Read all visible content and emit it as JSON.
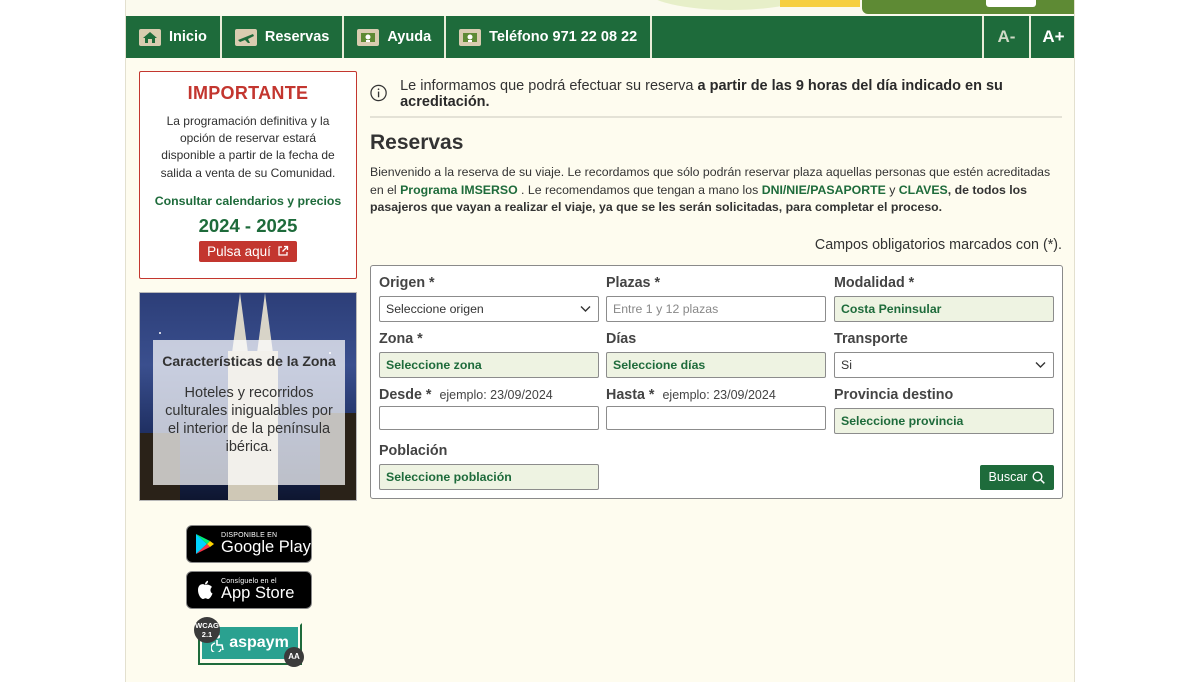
{
  "nav": {
    "items": [
      {
        "label": "Inicio",
        "icon": "home-icon"
      },
      {
        "label": "Reservas",
        "icon": "plane-icon"
      },
      {
        "label": "Ayuda",
        "icon": "help-icon"
      },
      {
        "label": "Teléfono 971 22 08 22",
        "icon": "phone-icon"
      }
    ],
    "font_smaller": "A-",
    "font_larger": "A+"
  },
  "important": {
    "title": "IMPORTANTE",
    "text": "La programación definitiva y la opción de reservar estará disponible a partir de la fecha de salida a venta de su Comunidad.",
    "link": "Consultar calendarios y precios",
    "years": "2024 - 2025",
    "button": "Pulsa aquí"
  },
  "zone": {
    "title": "Características de la Zona",
    "text": "Hoteles y recorridos culturales inigualables por el interior de la península ibérica."
  },
  "badges": {
    "google_small": "DISPONIBLE EN",
    "google_big": "Google Play",
    "apple_small": "Consíguelo en el",
    "apple_big": "App Store",
    "aspaym": "aspaym",
    "wcag": "WCAG 2.1",
    "aa": "AA"
  },
  "info": {
    "text_normal": "Le informamos que podrá efectuar su reserva ",
    "text_bold": "a partir de las 9 horas del día indicado en su acreditación."
  },
  "main": {
    "title": "Reservas",
    "welcome_1": "Bienvenido a la reserva de su viaje. Le recordamos que sólo podrán reservar plaza aquellas personas que estén acreditadas en el ",
    "welcome_link": "Programa IMSERSO",
    "welcome_2": " . Le recomendamos que tengan a mano los ",
    "welcome_dni": "DNI/NIE/PASAPORTE",
    "welcome_y": " y ",
    "welcome_claves": "CLAVES",
    "welcome_3": ", de todos los pasajeros que vayan a realizar el viaje, ya que se les serán solicitadas, para completar el proceso.",
    "mandatory": "Campos obligatorios marcados con (*)."
  },
  "form": {
    "origen_label": "Origen *",
    "origen_value": "Seleccione origen",
    "plazas_label": "Plazas *",
    "plazas_placeholder": "Entre 1 y 12 plazas",
    "modalidad_label": "Modalidad *",
    "modalidad_value": "Costa Peninsular",
    "zona_label": "Zona *",
    "zona_value": "Seleccione zona",
    "dias_label": "Días",
    "dias_value": "Seleccione días",
    "transporte_label": "Transporte",
    "transporte_value": "Si",
    "desde_label": "Desde *",
    "desde_example": "ejemplo: 23/09/2024",
    "hasta_label": "Hasta *",
    "hasta_example": "ejemplo: 23/09/2024",
    "provincia_label": "Provincia destino",
    "provincia_value": "Seleccione provincia",
    "poblacion_label": "Población",
    "poblacion_value": "Seleccione población",
    "buscar": "Buscar"
  },
  "colors": {
    "brand_green": "#1e6b3b",
    "important_red": "#c3362f",
    "background": "#fefcef"
  }
}
